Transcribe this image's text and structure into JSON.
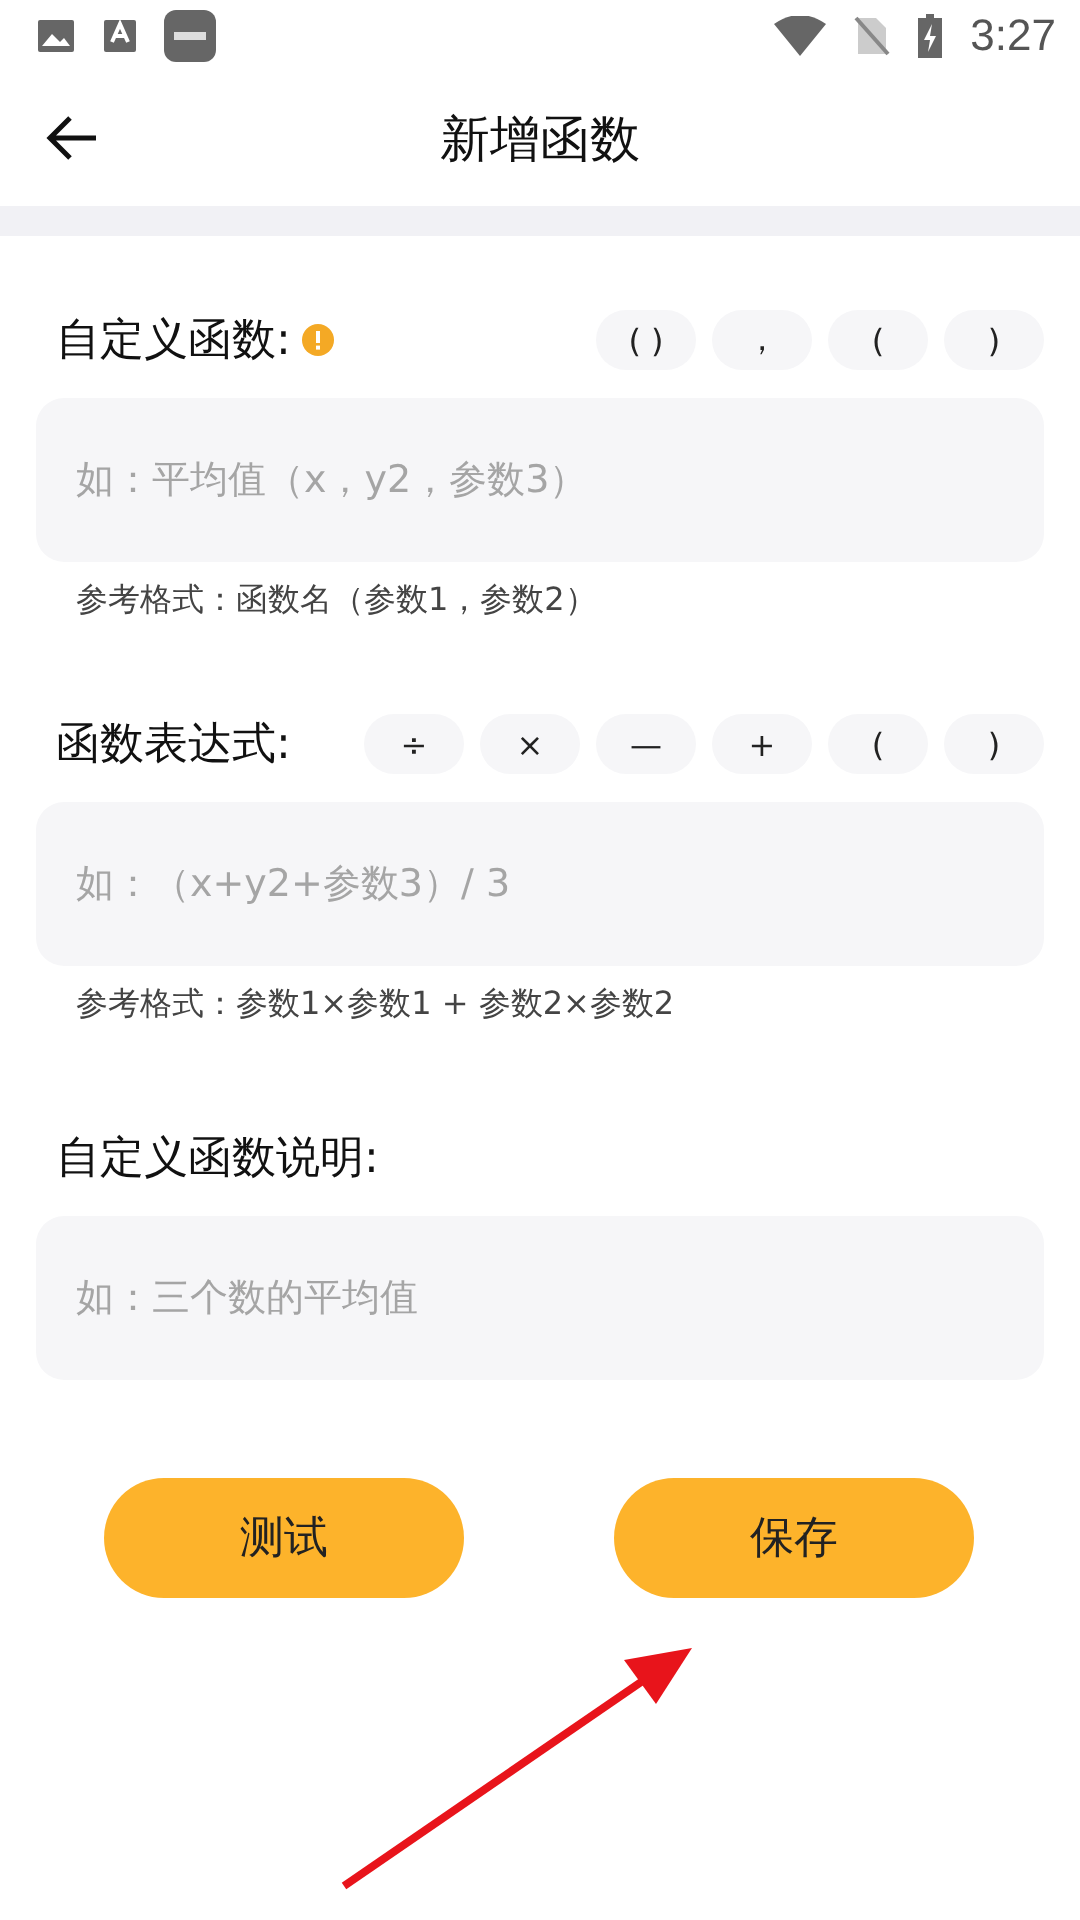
{
  "status_bar": {
    "time": "3:27"
  },
  "header": {
    "title": "新增函数"
  },
  "sections": [
    {
      "label": "自定义函数:",
      "info": true,
      "keys": [
        "( )",
        "，",
        "(",
        ")"
      ],
      "placeholder": "如：平均值（x，y2，参数3）",
      "hint": "参考格式：函数名（参数1，参数2）"
    },
    {
      "label": "函数表达式:",
      "info": false,
      "keys": [
        "÷",
        "×",
        "—",
        "+",
        "(",
        ")"
      ],
      "placeholder": "如：（x+y2+参数3）/ 3",
      "hint": "参考格式：参数1×参数1 + 参数2×参数2"
    },
    {
      "label": "自定义函数说明:",
      "info": false,
      "placeholder": "如：三个数的平均值"
    }
  ],
  "buttons": [
    "测试",
    "保存"
  ]
}
